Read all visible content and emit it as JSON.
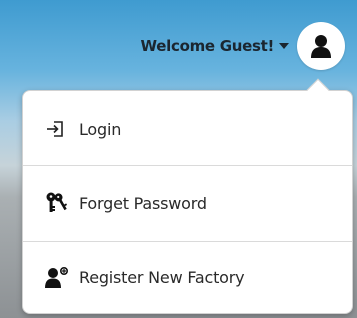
{
  "header": {
    "welcome_text": "Welcome Guest!",
    "caret_icon": "caret-down-icon",
    "avatar_icon": "user-icon"
  },
  "menu": {
    "items": [
      {
        "label": "Login",
        "icon": "sign-in-icon"
      },
      {
        "label": "Forget Password",
        "icon": "keys-icon"
      },
      {
        "label": "Register New Factory",
        "icon": "user-add-icon"
      }
    ]
  },
  "colors": {
    "header_blue": "#3f9bd0",
    "text_dark": "#1b2630",
    "menu_bg": "#ffffff"
  }
}
